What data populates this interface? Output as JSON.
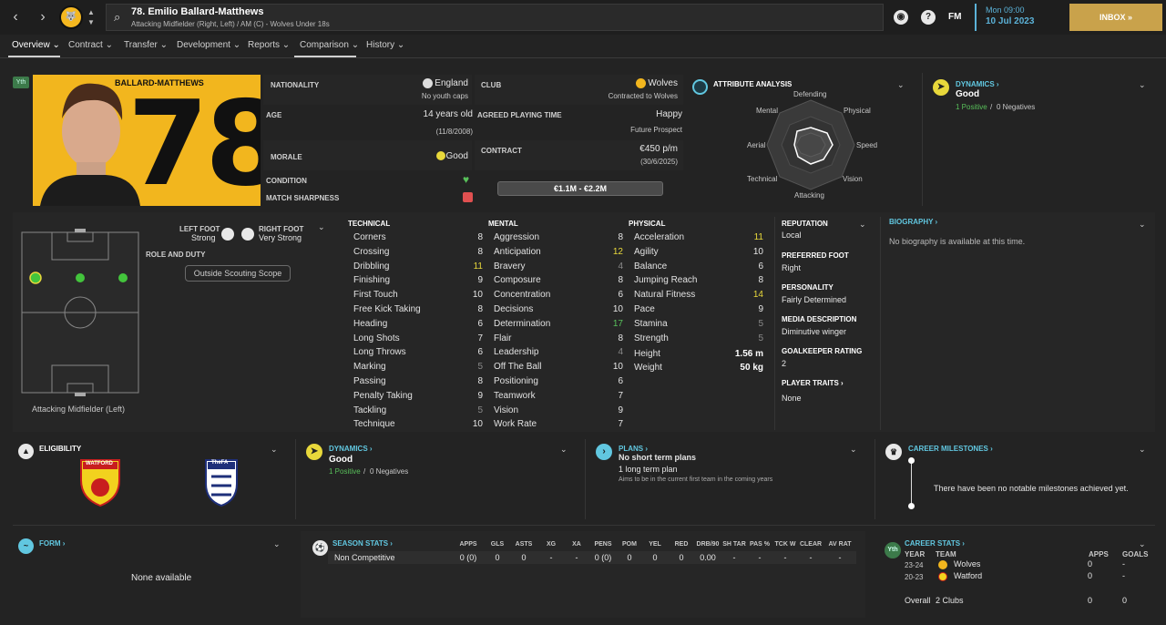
{
  "header": {
    "title": "78. Emilio Ballard-Matthews",
    "subtitle": "Attacking Midfielder (Right, Left) / AM (C) - Wolves Under 18s",
    "club_badge": "WOLVES",
    "fm": "FM",
    "time": "Mon 09:00",
    "date": "10 Jul 2023",
    "inbox": "INBOX"
  },
  "tabs": [
    "Overview",
    "Contract",
    "Transfer",
    "Development",
    "Reports",
    "Comparison",
    "History"
  ],
  "profile": {
    "badge": "Yth",
    "surname": "BALLARD-MATTHEWS",
    "number": "78"
  },
  "info": {
    "nationality_label": "NATIONALITY",
    "nationality": "England",
    "youth_caps": "No youth caps",
    "age_label": "AGE",
    "age": "14 years old",
    "dob": "(11/8/2008)",
    "morale_label": "MORALE",
    "morale": "Good",
    "condition_label": "CONDITION",
    "sharpness_label": "MATCH SHARPNESS",
    "club_label": "CLUB",
    "club": "Wolves",
    "club_sub": "Contracted to Wolves",
    "playing_time_label": "AGREED PLAYING TIME",
    "playing_time": "Happy",
    "playing_time_sub": "Future Prospect",
    "contract_label": "CONTRACT",
    "wage": "€450 p/m",
    "contract_end": "(30/6/2025)",
    "value_range": "€1.1M - €2.2M"
  },
  "analysis": {
    "title": "ATTRIBUTE ANALYSIS",
    "axes": [
      "Defending",
      "Physical",
      "Speed",
      "Vision",
      "Attacking",
      "Technical",
      "Aerial",
      "Mental"
    ]
  },
  "dynamics_top": {
    "title": "DYNAMICS",
    "value": "Good",
    "positive": "1 Positive",
    "sep": "/",
    "negative": "0 Negatives"
  },
  "pitch": {
    "left_foot_label": "LEFT FOOT",
    "left_foot": "Strong",
    "right_foot_label": "RIGHT FOOT",
    "right_foot": "Very Strong",
    "role_label": "ROLE AND DUTY",
    "scouting_btn": "Outside Scouting Scope",
    "position": "Attacking Midfielder (Left)"
  },
  "technical": {
    "title": "TECHNICAL",
    "items": [
      {
        "n": "Corners",
        "v": "8"
      },
      {
        "n": "Crossing",
        "v": "8"
      },
      {
        "n": "Dribbling",
        "v": "11"
      },
      {
        "n": "Finishing",
        "v": "9"
      },
      {
        "n": "First Touch",
        "v": "10"
      },
      {
        "n": "Free Kick Taking",
        "v": "8"
      },
      {
        "n": "Heading",
        "v": "6"
      },
      {
        "n": "Long Shots",
        "v": "7"
      },
      {
        "n": "Long Throws",
        "v": "6"
      },
      {
        "n": "Marking",
        "v": "5"
      },
      {
        "n": "Passing",
        "v": "8"
      },
      {
        "n": "Penalty Taking",
        "v": "9"
      },
      {
        "n": "Tackling",
        "v": "5"
      },
      {
        "n": "Technique",
        "v": "10"
      }
    ]
  },
  "mental": {
    "title": "MENTAL",
    "items": [
      {
        "n": "Aggression",
        "v": "8"
      },
      {
        "n": "Anticipation",
        "v": "12"
      },
      {
        "n": "Bravery",
        "v": "4"
      },
      {
        "n": "Composure",
        "v": "8"
      },
      {
        "n": "Concentration",
        "v": "6"
      },
      {
        "n": "Decisions",
        "v": "10"
      },
      {
        "n": "Determination",
        "v": "17"
      },
      {
        "n": "Flair",
        "v": "8"
      },
      {
        "n": "Leadership",
        "v": "4"
      },
      {
        "n": "Off The Ball",
        "v": "10"
      },
      {
        "n": "Positioning",
        "v": "6"
      },
      {
        "n": "Teamwork",
        "v": "7"
      },
      {
        "n": "Vision",
        "v": "9"
      },
      {
        "n": "Work Rate",
        "v": "7"
      }
    ]
  },
  "physical": {
    "title": "PHYSICAL",
    "items": [
      {
        "n": "Acceleration",
        "v": "11"
      },
      {
        "n": "Agility",
        "v": "10"
      },
      {
        "n": "Balance",
        "v": "6"
      },
      {
        "n": "Jumping Reach",
        "v": "8"
      },
      {
        "n": "Natural Fitness",
        "v": "14"
      },
      {
        "n": "Pace",
        "v": "9"
      },
      {
        "n": "Stamina",
        "v": "5"
      },
      {
        "n": "Strength",
        "v": "5"
      }
    ],
    "height_label": "Height",
    "height": "1.56 m",
    "weight_label": "Weight",
    "weight": "50 kg"
  },
  "details": {
    "reputation_label": "REPUTATION",
    "reputation": "Local",
    "pref_foot_label": "PREFERRED FOOT",
    "pref_foot": "Right",
    "personality_label": "PERSONALITY",
    "personality": "Fairly Determined",
    "media_label": "MEDIA DESCRIPTION",
    "media": "Diminutive winger",
    "gk_label": "GOALKEEPER RATING",
    "gk": "2",
    "traits_label": "PLAYER TRAITS",
    "traits": "None"
  },
  "biography": {
    "title": "BIOGRAPHY",
    "text": "No biography is available at this time."
  },
  "eligibility": {
    "title": "ELIGIBILITY",
    "club_crest": "WATFORD",
    "fa_crest": "TheFA"
  },
  "dynamics_mid": {
    "title": "DYNAMICS",
    "value": "Good",
    "positive": "1 Positive",
    "sep": "/",
    "negative": "0 Negatives"
  },
  "plans": {
    "title": "PLANS",
    "short": "No short term plans",
    "long": "1 long term plan",
    "long_sub": "Aims to be in the current first team in the coming years"
  },
  "milestones": {
    "title": "CAREER MILESTONES",
    "text": "There have been no notable milestones achieved yet."
  },
  "form": {
    "title": "FORM",
    "text": "None available"
  },
  "season_stats": {
    "title": "SEASON STATS",
    "headers": [
      "APPS",
      "GLS",
      "ASTS",
      "XG",
      "XA",
      "PENS",
      "POM",
      "YEL",
      "RED",
      "DRB/90",
      "SH TAR",
      "PAS %",
      "TCK W",
      "CLEAR",
      "AV RAT"
    ],
    "row_label": "Non Competitive",
    "values": [
      "0 (0)",
      "0",
      "0",
      "-",
      "-",
      "0 (0)",
      "0",
      "0",
      "0",
      "0.00",
      "-",
      "-",
      "-",
      "-",
      "-"
    ]
  },
  "career_stats": {
    "title": "CAREER STATS",
    "badge": "Yth",
    "year_h": "YEAR",
    "team_h": "TEAM",
    "apps_h": "APPS",
    "goals_h": "GOALS",
    "rows": [
      {
        "year": "23-24",
        "team": "Wolves",
        "apps": "0",
        "goals": "-"
      },
      {
        "year": "20-23",
        "team": "Watford",
        "apps": "0",
        "goals": "-"
      }
    ],
    "overall_label": "Overall",
    "overall_clubs": "2 Clubs",
    "overall_apps": "0",
    "overall_goals": "0"
  }
}
